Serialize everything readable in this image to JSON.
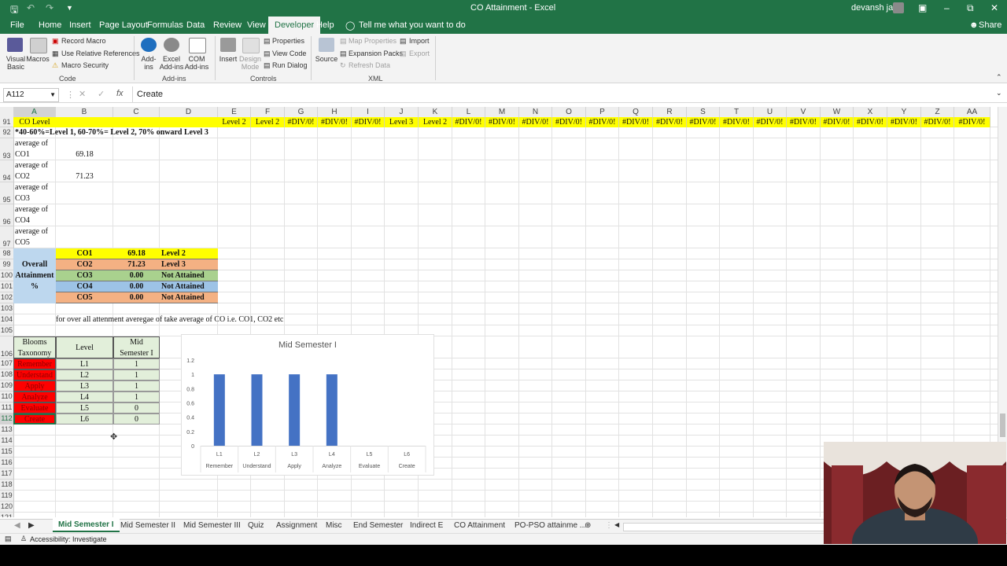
{
  "titlebar": {
    "title": "CO Attainment  -  Excel",
    "user": "devansh jain",
    "share": "Share"
  },
  "menu": {
    "tabs": [
      "File",
      "Home",
      "Insert",
      "Page Layout",
      "Formulas",
      "Data",
      "Review",
      "View",
      "Developer",
      "Help"
    ],
    "active": "Developer",
    "tell_me": "Tell me what you want to do"
  },
  "ribbon": {
    "code": {
      "visual_basic": "Visual\nBasic",
      "macros": "Macros",
      "record_macro": "Record Macro",
      "use_relative": "Use Relative References",
      "macro_security": "Macro Security",
      "group": "Code"
    },
    "addins": {
      "addins": "Add-\nins",
      "excel_addins": "Excel\nAdd-ins",
      "com_addins": "COM\nAdd-ins",
      "group": "Add-ins"
    },
    "controls": {
      "insert": "Insert",
      "design_mode": "Design\nMode",
      "properties": "Properties",
      "view_code": "View Code",
      "run_dialog": "Run Dialog",
      "group": "Controls"
    },
    "xml": {
      "source": "Source",
      "map_properties": "Map Properties",
      "expansion_packs": "Expansion Packs",
      "refresh_data": "Refresh Data",
      "import": "Import",
      "export": "Export",
      "group": "XML"
    }
  },
  "formula_bar": {
    "name_box": "A112",
    "fx": "fx",
    "value": "Create"
  },
  "columns": [
    "A",
    "B",
    "C",
    "D",
    "E",
    "F",
    "G",
    "H",
    "I",
    "J",
    "K",
    "L",
    "M",
    "N",
    "O",
    "P",
    "Q",
    "R",
    "S",
    "T",
    "U",
    "V",
    "W",
    "X",
    "Y",
    "Z",
    "AA"
  ],
  "rows": [
    "91",
    "92",
    "93",
    "94",
    "95",
    "96",
    "97",
    "98",
    "99",
    "100",
    "101",
    "102",
    "103",
    "104",
    "105",
    "106",
    "107",
    "108",
    "109",
    "110",
    "111",
    "112",
    "113",
    "114",
    "115",
    "116",
    "117",
    "118",
    "119",
    "120",
    "121"
  ],
  "sheet": {
    "r91": {
      "a": "CO Level",
      "levels": [
        "Level 2",
        "Level 2",
        "#DIV/0!",
        "#DIV/0!",
        "#DIV/0!",
        "Level 3",
        "Level 2",
        "#DIV/0!",
        "#DIV/0!",
        "#DIV/0!",
        "#DIV/0!",
        "#DIV/0!",
        "#DIV/0!",
        "#DIV/0!",
        "#DIV/0!",
        "#DIV/0!",
        "#DIV/0!",
        "#DIV/0!",
        "#DIV/0!",
        "#DIV/0!",
        "#DIV/0!",
        "#DIV/0!",
        "#DIV/0!"
      ]
    },
    "r92": "*40-60%=Level 1, 60-70%= Level 2, 70% onward Level 3",
    "averages": [
      {
        "l1": "average of",
        "l2": "CO1",
        "val": "69.18"
      },
      {
        "l1": "average of",
        "l2": "CO2",
        "val": "71.23"
      },
      {
        "l1": "average of",
        "l2": "CO3",
        "val": ""
      },
      {
        "l1": "average of",
        "l2": "CO4",
        "val": ""
      },
      {
        "l1": "average of",
        "l2": "CO5",
        "val": ""
      }
    ],
    "overall_label": [
      "Overall",
      "Attainment",
      "%"
    ],
    "attainment": [
      {
        "co": "CO1",
        "pct": "69.18",
        "level": "Level 2",
        "bg": "#ffff00",
        "levelbg": "#ffff00"
      },
      {
        "co": "CO2",
        "pct": "71.23",
        "level": "Level 3",
        "bg": "#f4b183",
        "levelbg": "#f4b183"
      },
      {
        "co": "CO3",
        "pct": "0.00",
        "level": "Not Attained",
        "bg": "#a9d18e",
        "levelbg": "#a9d18e"
      },
      {
        "co": "CO4",
        "pct": "0.00",
        "level": "Not Attained",
        "bg": "#9dc3e6",
        "levelbg": "#9dc3e6"
      },
      {
        "co": "CO5",
        "pct": "0.00",
        "level": "Not Attained",
        "bg": "#f4b183",
        "levelbg": "#f4b183"
      }
    ],
    "r104": "for over all attenment averegae of take average of CO i.e. CO1, CO2 etc",
    "blooms_header": {
      "a1": "Blooms",
      "a2": "Taxonomy",
      "b": "Level",
      "c1": "Mid",
      "c2": "Semester I"
    },
    "blooms": [
      {
        "name": "Remember",
        "level": "L1",
        "val": "1"
      },
      {
        "name": "Understand",
        "level": "L2",
        "val": "1"
      },
      {
        "name": "Apply",
        "level": "L3",
        "val": "1"
      },
      {
        "name": "Analyze",
        "level": "L4",
        "val": "1"
      },
      {
        "name": "Evaluate",
        "level": "L5",
        "val": "0"
      },
      {
        "name": "Create",
        "level": "L6",
        "val": "0"
      }
    ]
  },
  "chart_data": {
    "type": "bar",
    "title": "Mid Semester I",
    "categories": [
      "L1",
      "L2",
      "L3",
      "L4",
      "L5",
      "L6"
    ],
    "sub_categories": [
      "Remember",
      "Understand",
      "Apply",
      "Analyze",
      "Evaluate",
      "Create"
    ],
    "values": [
      1,
      1,
      1,
      1,
      0,
      0
    ],
    "ylim": [
      0,
      1.2
    ],
    "yticks": [
      "0",
      "0.2",
      "0.4",
      "0.6",
      "0.8",
      "1",
      "1.2"
    ],
    "bar_color": "#4472c4",
    "grid": false
  },
  "sheet_tabs": [
    "Mid Semester I",
    "Mid Semester II",
    "Mid Semester III",
    "Quiz",
    "Assignment",
    "Misc",
    "End Semester",
    "Indirect E",
    "CO Attainment",
    "PO-PSO attainme ..."
  ],
  "active_sheet": "Mid Semester I",
  "status": "Accessibility: Investigate",
  "colors": {
    "excel_green": "#217346",
    "header_yellow": "#ffff00",
    "blooms_red": "#ff0000",
    "blooms_green": "#e2efda"
  }
}
